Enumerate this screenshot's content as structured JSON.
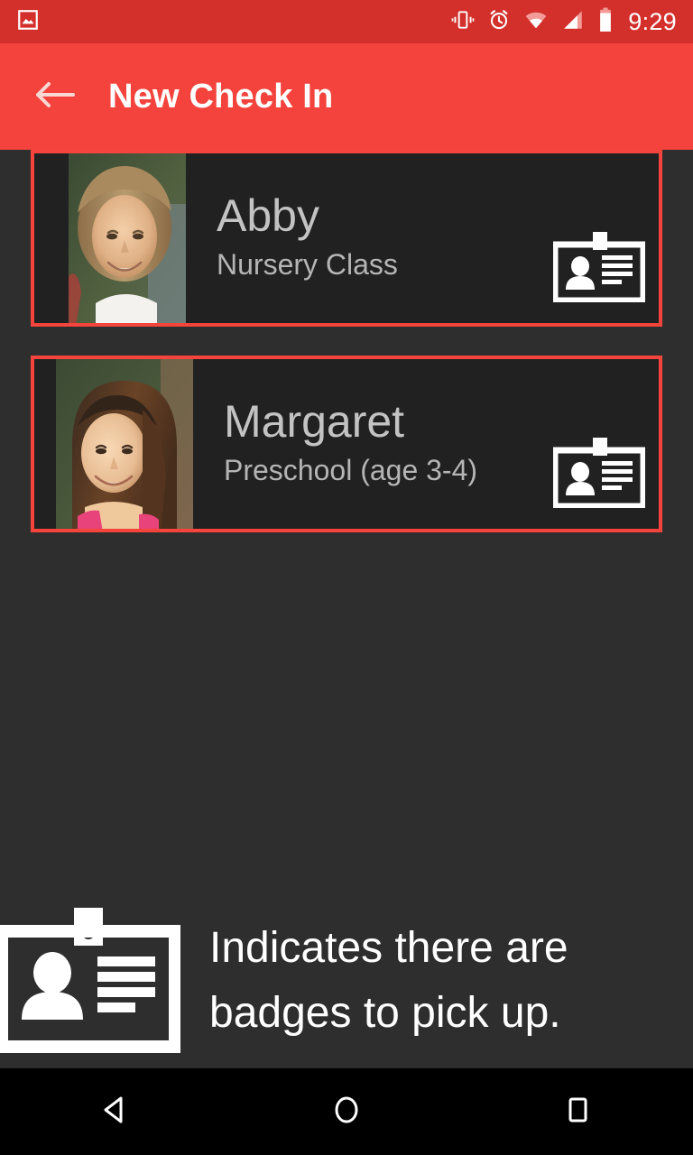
{
  "status_bar": {
    "time": "9:29",
    "left_icons": [
      {
        "name": "photo-notification-icon"
      }
    ],
    "right_icons": [
      {
        "name": "vibrate-icon"
      },
      {
        "name": "alarm-clock-icon"
      },
      {
        "name": "wifi-icon"
      },
      {
        "name": "cell-signal-icon"
      },
      {
        "name": "battery-icon"
      }
    ],
    "background_color": "#d3302c"
  },
  "app_bar": {
    "title": "New Check In",
    "back_icon": "arrow-left-icon",
    "background_color": "#f4433c",
    "text_color": "#ffffff"
  },
  "theme": {
    "page_background": "#2e2e2e",
    "card_background": "#212121",
    "highlight_border": "#f4443c",
    "primary_text": "#c3c3c3",
    "secondary_text": "#b5b5b5",
    "legend_text": "#ffffff"
  },
  "checkin_list": [
    {
      "name": "Abby",
      "class": "Nursery Class",
      "badge_icon": "id-badge-icon",
      "has_badge": true,
      "avatar_name": "avatar-abby"
    },
    {
      "name": "Margaret",
      "class": "Preschool (age 3-4)",
      "badge_icon": "id-badge-icon",
      "has_badge": true,
      "avatar_name": "avatar-margaret"
    }
  ],
  "legend": {
    "icon": "id-badge-icon",
    "text": "Indicates there are badges to pick up."
  },
  "nav_bar": {
    "back_label": "back-triangle-icon",
    "home_label": "home-circle-icon",
    "recents_label": "recents-square-icon"
  }
}
